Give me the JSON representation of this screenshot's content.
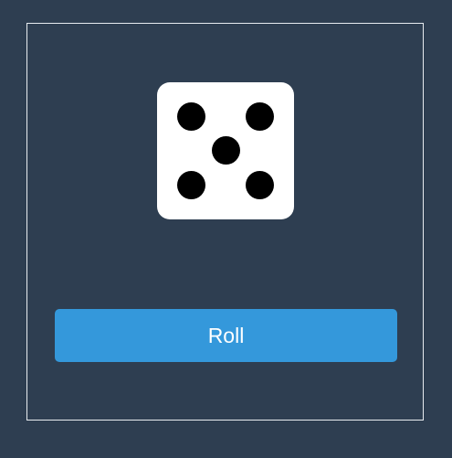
{
  "die": {
    "face_value": 5,
    "pips": [
      "top-left",
      "top-right",
      "center",
      "bottom-left",
      "bottom-right"
    ]
  },
  "controls": {
    "roll_label": "Roll"
  },
  "colors": {
    "background": "#2e3e51",
    "die_face": "#ffffff",
    "pip": "#000000",
    "button": "#3498db",
    "button_text": "#ffffff",
    "frame_border": "#e8ecf0"
  }
}
